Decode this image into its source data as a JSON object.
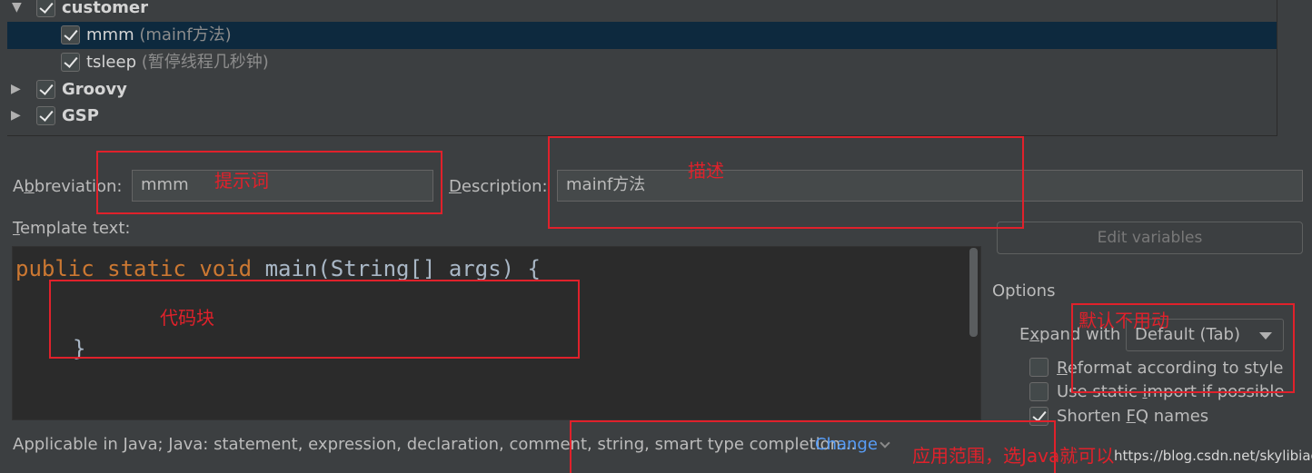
{
  "tree": {
    "items": [
      {
        "name": "customer",
        "desc": "",
        "checked": true,
        "expanded": true,
        "selected": false
      },
      {
        "name": "mmm",
        "desc": "(mainf方法)",
        "checked": true,
        "selected": true
      },
      {
        "name": "tsleep",
        "desc": "(暂停线程几秒钟)",
        "checked": true,
        "selected": false
      },
      {
        "name": "Groovy",
        "desc": "",
        "checked": true,
        "expanded": false
      },
      {
        "name": "GSP",
        "desc": "",
        "checked": true,
        "expanded": false
      }
    ]
  },
  "form": {
    "abbreviation_label_pre": "A",
    "abbreviation_label_u": "b",
    "abbreviation_label_post": "breviation:",
    "abbreviation_value": "mmm",
    "description_label_u": "D",
    "description_label_post": "escription:",
    "description_value": "mainf方法",
    "template_label_u": "T",
    "template_label_post": "emplate text:"
  },
  "editor": {
    "kw1": "public",
    "kw2": "static",
    "kw3": "void",
    "signature": "main(String[] args) {",
    "closing": "}"
  },
  "right": {
    "edit_variables": "Edit variables",
    "options_title": "Options",
    "expand_with_pre": "E",
    "expand_with_u": "x",
    "expand_with_post": "pand with",
    "expand_value": "Default (Tab)",
    "reformat_u": "R",
    "reformat_post": "eformat according to style",
    "reformat_checked": false,
    "static_pre": "Use static ",
    "static_u": "i",
    "static_post": "mport if possible",
    "static_checked": false,
    "shorten_pre": "Shorten ",
    "shorten_u": "F",
    "shorten_post": "Q names",
    "shorten_checked": true
  },
  "footer": {
    "applicable": "Applicable in Java; Java: statement, expression, declaration, comment, string, smart type completion...",
    "change": "Change"
  },
  "annotations": {
    "abbreviation_note": "提示词",
    "description_note": "描述",
    "code_note": "代码块",
    "expand_note": "默认不用动",
    "scope_note": "应用范围，选Java就可以",
    "watermark": "https://blog.csdn.net/skylibiao"
  },
  "colors": {
    "background": "#3c3f41",
    "editor_bg": "#2b2b2b",
    "keyword": "#cc7832",
    "selection": "#0d293e",
    "link": "#589df6",
    "annotation_red": "#e0212b"
  }
}
